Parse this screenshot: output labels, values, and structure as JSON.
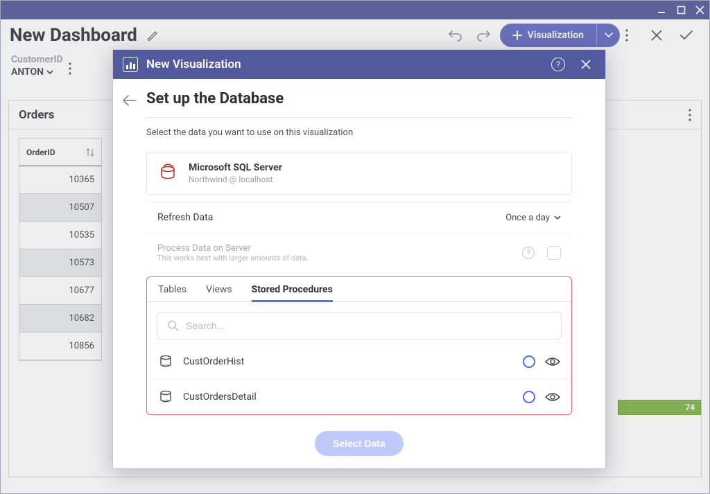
{
  "window": {
    "title": "New Dashboard"
  },
  "toolbar": {
    "visualization_label": "Visualization"
  },
  "filter": {
    "label": "CustomerID",
    "value": "ANTON"
  },
  "orders_card": {
    "title": "Orders",
    "column": "OrderID",
    "rows": [
      "10365",
      "10507",
      "10535",
      "10573",
      "10677",
      "10682",
      "10856"
    ]
  },
  "green_value": "74",
  "modal": {
    "header_title": "New Visualization",
    "title": "Set up the Database",
    "subtitle": "Select the data you want to use on this visualization",
    "datasource": {
      "name": "Microsoft SQL Server",
      "detail": "Northwind @ localhost"
    },
    "refresh": {
      "label": "Refresh Data",
      "value": "Once a day"
    },
    "process": {
      "title": "Process Data on Server",
      "subtitle": "This works best with larger amounts of data."
    },
    "tabs": [
      "Tables",
      "Views",
      "Stored Procedures"
    ],
    "active_tab": 2,
    "search_placeholder": "Search...",
    "stored_procedures": [
      "CustOrderHist",
      "CustOrdersDetail"
    ],
    "select_button": "Select Data"
  }
}
